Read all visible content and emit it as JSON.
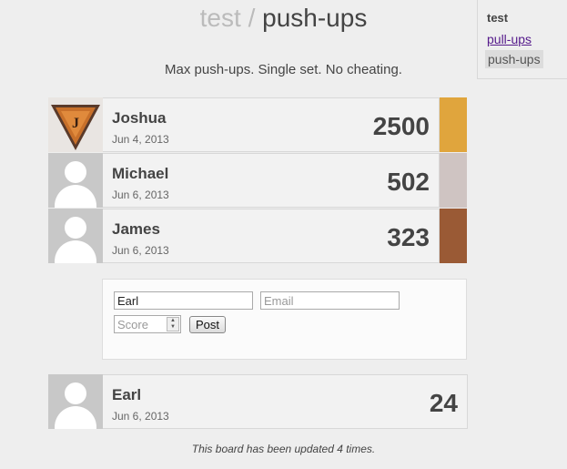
{
  "header": {
    "board": "test",
    "separator": "/",
    "title": "push-ups"
  },
  "subtitle": "Max push-ups. Single set. No cheating.",
  "side": {
    "heading": "test",
    "link": "pull-ups",
    "current": "push-ups"
  },
  "entries": [
    {
      "name": "Joshua",
      "date": "Jun 4, 2013",
      "score": "2500",
      "swatch": "#e0a53d",
      "avatar": "badge-icon"
    },
    {
      "name": "Michael",
      "date": "Jun 6, 2013",
      "score": "502",
      "swatch": "#cfc4c2",
      "avatar": "default-avatar-icon"
    },
    {
      "name": "James",
      "date": "Jun 6, 2013",
      "score": "323",
      "swatch": "#9a5a35",
      "avatar": "default-avatar-icon"
    }
  ],
  "form": {
    "name_value": "Earl",
    "email_placeholder": "Email",
    "score_placeholder": "Score",
    "post_label": "Post"
  },
  "preview": {
    "name": "Earl",
    "date": "Jun 6, 2013",
    "score": "24"
  },
  "footer": "This board has been updated 4 times."
}
